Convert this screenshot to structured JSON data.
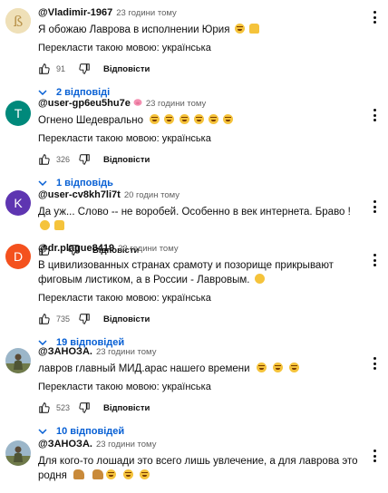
{
  "comments": [
    {
      "author": "@Vladimir-1967",
      "time": "23 години тому",
      "text": "Я обожаю Лаврова в исполнении Юрия",
      "emojis": [
        "laughing-emoji",
        "thumbs-up-emoji"
      ],
      "translate_label": "Перекласти такою мовою: українська",
      "likes": "91",
      "reply_label": "Відповісти",
      "replies_label": "2 відповіді",
      "avatar_color": "#efe0b8"
    },
    {
      "author": "@user-gp6eu5hu7e",
      "time": "23 години тому",
      "text": "Огнено Шедеврально",
      "translate_label": "Перекласти такою мовою: українська",
      "likes": "326",
      "reply_label": "Відповісти",
      "replies_label": "1 відповідь",
      "avatar_letter": "T",
      "avatar_color": "#00897b"
    },
    {
      "author": "@user-cv8kh7li7t",
      "time": "20 годин тому",
      "text": "Да уж... Слово -- не воробей. Особенно в век интернета. Браво !",
      "likes": "",
      "reply_label": "Відповісти",
      "avatar_letter": "K",
      "avatar_color": "#5e35b1"
    },
    {
      "author": "@dr.plague8419",
      "time": "23 години тому",
      "text": "В цивилизованных странах срамоту и позорище прикрывают фиговым листиком, а в России - Лавровым.",
      "translate_label": "Перекласти такою мовою: українська",
      "likes": "735",
      "reply_label": "Відповісти",
      "replies_label": "19 відповідей",
      "avatar_letter": "D",
      "avatar_color": "#f4511e"
    },
    {
      "author": "@ЗАНОЗА.",
      "time": "23 години тому",
      "text": "лавров главный МИД.арас нашего времени",
      "translate_label": "Перекласти такою мовою: українська",
      "likes": "523",
      "reply_label": "Відповісти",
      "replies_label": "10 відповідей"
    },
    {
      "author": "@ЗАНОЗА.",
      "time": "23 години тому",
      "text": "Для кого-то лошади это всего лишь увлечение, а для лаврова это родня"
    }
  ],
  "colors": {
    "link_blue": "#065fd4",
    "secondary_text": "#606060"
  }
}
